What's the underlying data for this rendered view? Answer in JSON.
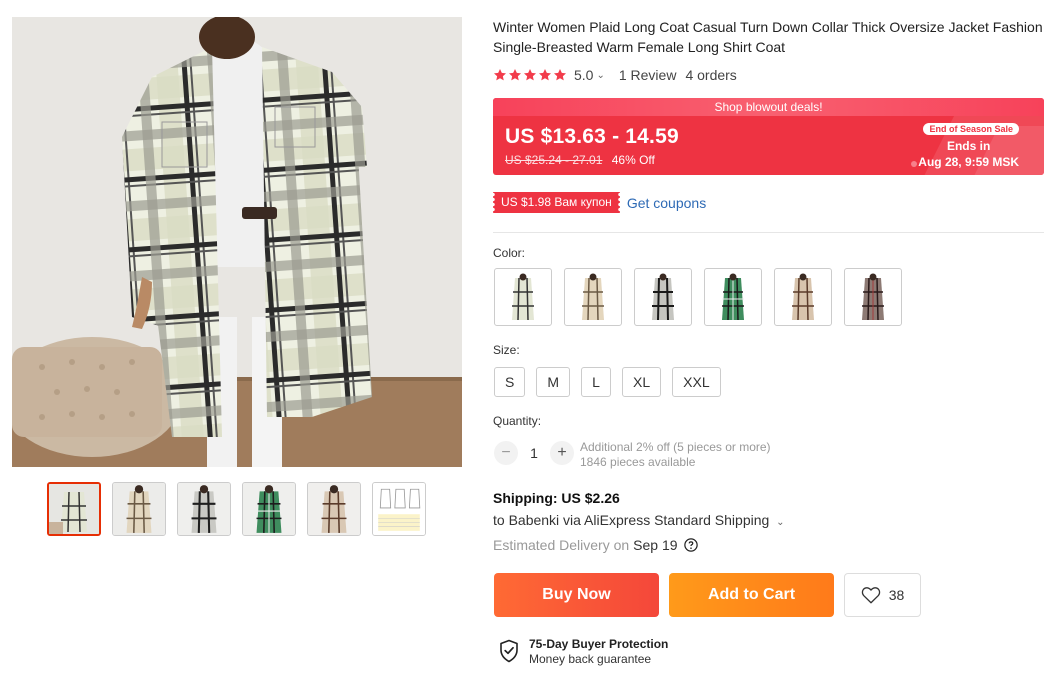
{
  "product": {
    "title": "Winter Women Plaid Long Coat Casual Turn Down Collar Thick Oversize Jacket Fashion Single-Breasted Warm Female Long Shirt Coat",
    "rating": "5.0",
    "reviews": "1 Review",
    "orders": "4 orders"
  },
  "price": {
    "banner": "Shop blowout deals!",
    "current": "US $13.63 - 14.59",
    "original": "US $25.24 - 27.01",
    "discount": "46% Off",
    "sale_badge": "End of Season Sale",
    "ends_label": "Ends in",
    "ends_time": "Aug 28, 9:59 MSK"
  },
  "coupon": {
    "tag": "US $1.98 Вам купон",
    "link": "Get coupons"
  },
  "color": {
    "label": "Color:",
    "options": [
      "grey-white-plaid",
      "beige-plaid",
      "black-grey-plaid",
      "green-plaid",
      "brown-plaid",
      "dark-red-plaid"
    ]
  },
  "size": {
    "label": "Size:",
    "options": [
      "S",
      "M",
      "L",
      "XL",
      "XXL"
    ]
  },
  "quantity": {
    "label": "Quantity:",
    "value": "1",
    "minus": "−",
    "plus": "+",
    "discount_note": "Additional 2% off (5 pieces or more)",
    "available": "1846 pieces available"
  },
  "shipping": {
    "title": "Shipping: US $2.26",
    "line": "to Babenki via AliExpress Standard Shipping",
    "estimated_label": "Estimated Delivery on",
    "estimated_date": "Sep 19"
  },
  "actions": {
    "buy_now": "Buy Now",
    "add_to_cart": "Add to Cart",
    "wishlist_count": "38"
  },
  "protection": {
    "title": "75-Day Buyer Protection",
    "subtitle": "Money back guarantee"
  },
  "colors_meta": {
    "accent": "#ee3342",
    "buy": "#f4473a",
    "cart": "#ff9a1a",
    "link": "#2e6ab5",
    "star": "#f23c4b"
  }
}
